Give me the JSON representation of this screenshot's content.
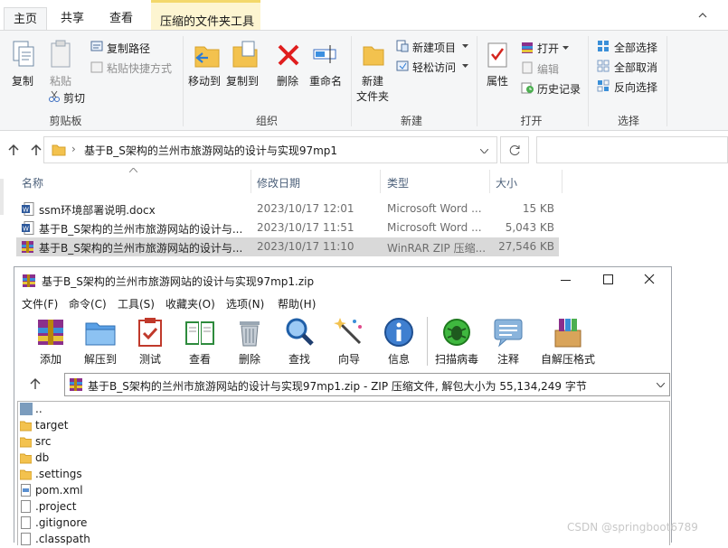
{
  "ribbon": {
    "tabs": [
      "主页",
      "共享",
      "查看"
    ],
    "context_tab": "压缩的文件夹工具",
    "clipboard": {
      "copy": "复制",
      "paste": "粘贴",
      "copy_path": "复制路径",
      "paste_shortcut": "粘贴快捷方式",
      "cut": "剪切",
      "group": "剪贴板"
    },
    "organize": {
      "move_to": "移动到",
      "copy_to": "复制到",
      "delete": "删除",
      "rename": "重命名",
      "group": "组织"
    },
    "new": {
      "new_folder_line1": "新建",
      "new_folder_line2": "文件夹",
      "new_item": "新建项目",
      "easy_access": "轻松访问",
      "group": "新建"
    },
    "open": {
      "properties": "属性",
      "open": "打开",
      "edit": "编辑",
      "history": "历史记录",
      "group": "打开"
    },
    "select": {
      "select_all": "全部选择",
      "select_none": "全部取消",
      "invert": "反向选择",
      "group": "选择"
    }
  },
  "address": {
    "path": "基于B_S架构的兰州市旅游网站的设计与实现97mp1"
  },
  "columns": {
    "name": "名称",
    "date": "修改日期",
    "type": "类型",
    "size": "大小"
  },
  "files": [
    {
      "name": "ssm环境部署说明.docx",
      "date": "2023/10/17 12:01",
      "type": "Microsoft Word ...",
      "size": "15 KB",
      "icon": "word"
    },
    {
      "name": "基于B_S架构的兰州市旅游网站的设计与...",
      "date": "2023/10/17 11:51",
      "type": "Microsoft Word ...",
      "size": "5,043 KB",
      "icon": "word"
    },
    {
      "name": "基于B_S架构的兰州市旅游网站的设计与...",
      "date": "2023/10/17 11:10",
      "type": "WinRAR ZIP 压缩...",
      "size": "27,546 KB",
      "icon": "winrar"
    }
  ],
  "winrar": {
    "title": "基于B_S架构的兰州市旅游网站的设计与实现97mp1.zip",
    "menu": [
      "文件(F)",
      "命令(C)",
      "工具(S)",
      "收藏夹(O)",
      "选项(N)",
      "帮助(H)"
    ],
    "tools": [
      "添加",
      "解压到",
      "测试",
      "查看",
      "删除",
      "查找",
      "向导",
      "信息",
      "扫描病毒",
      "注释",
      "自解压格式"
    ],
    "path": "基于B_S架构的兰州市旅游网站的设计与实现97mp1.zip - ZIP 压缩文件, 解包大小为 55,134,249 字节",
    "entries": [
      {
        "name": "..",
        "kind": "up"
      },
      {
        "name": "target",
        "kind": "folder"
      },
      {
        "name": "src",
        "kind": "folder"
      },
      {
        "name": "db",
        "kind": "folder"
      },
      {
        "name": ".settings",
        "kind": "folder"
      },
      {
        "name": "pom.xml",
        "kind": "xml"
      },
      {
        "name": ".project",
        "kind": "file"
      },
      {
        "name": ".gitignore",
        "kind": "file"
      },
      {
        "name": ".classpath",
        "kind": "file"
      }
    ]
  },
  "watermark": "CSDN @springboot6789"
}
